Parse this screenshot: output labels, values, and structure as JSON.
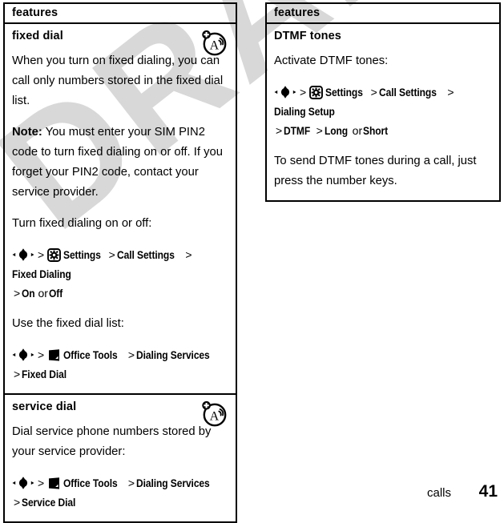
{
  "document": {
    "watermark_text": "DRAFT",
    "watermark_color": "#d8d8d8"
  },
  "footer": {
    "chapter": "calls",
    "page_number": "41"
  },
  "left_table": {
    "header": "features",
    "sections": [
      {
        "title": "fixed dial",
        "badge_icon": "sim-network-feature-icon",
        "blocks": [
          {
            "kind": "para",
            "text": "When you turn on fixed dialing, you can call only numbers stored in the fixed dial list."
          },
          {
            "kind": "note",
            "label": "Note:",
            "text": " You must enter your SIM PIN2 code to turn fixed dialing on or off. If you forget your PIN2 code, contact your service provider."
          },
          {
            "kind": "para",
            "text": "Turn fixed dialing on or off:"
          },
          {
            "kind": "navpath",
            "items": [
              {
                "type": "icon",
                "icon": "joystick-icon"
              },
              {
                "type": "sep",
                "text": ">"
              },
              {
                "type": "icon",
                "icon": "settings-gear-icon"
              },
              {
                "type": "nav",
                "text": "Settings"
              },
              {
                "type": "sep",
                "text": ">"
              },
              {
                "type": "nav",
                "text": "Call Settings"
              },
              {
                "type": "sep",
                "text": ">"
              },
              {
                "type": "nav",
                "text": "Fixed Dialing"
              },
              {
                "type": "break"
              },
              {
                "type": "sep",
                "text": ">"
              },
              {
                "type": "nav",
                "text": "On"
              },
              {
                "type": "plain",
                "text": "or"
              },
              {
                "type": "nav",
                "text": "Off"
              }
            ]
          },
          {
            "kind": "para",
            "text": "Use the fixed dial list:"
          },
          {
            "kind": "navpath",
            "items": [
              {
                "type": "icon",
                "icon": "joystick-icon"
              },
              {
                "type": "sep",
                "text": ">"
              },
              {
                "type": "icon",
                "icon": "office-tools-icon"
              },
              {
                "type": "nav",
                "text": "Office Tools"
              },
              {
                "type": "sep",
                "text": ">"
              },
              {
                "type": "nav",
                "text": "Dialing Services"
              },
              {
                "type": "sep",
                "text": ">"
              },
              {
                "type": "nav",
                "text": "Fixed Dial"
              }
            ]
          }
        ]
      },
      {
        "title": "service dial",
        "badge_icon": "sim-network-feature-icon",
        "blocks": [
          {
            "kind": "para",
            "text": "Dial service phone numbers stored by your service provider:"
          },
          {
            "kind": "navpath",
            "items": [
              {
                "type": "icon",
                "icon": "joystick-icon"
              },
              {
                "type": "sep",
                "text": ">"
              },
              {
                "type": "icon",
                "icon": "office-tools-icon"
              },
              {
                "type": "nav",
                "text": "Office Tools"
              },
              {
                "type": "sep",
                "text": ">"
              },
              {
                "type": "nav",
                "text": "Dialing Services"
              },
              {
                "type": "break"
              },
              {
                "type": "sep",
                "text": ">"
              },
              {
                "type": "nav",
                "text": "Service Dial"
              }
            ]
          }
        ]
      }
    ]
  },
  "right_table": {
    "header": "features",
    "sections": [
      {
        "title": "DTMF tones",
        "badge_icon": null,
        "blocks": [
          {
            "kind": "para",
            "text": "Activate DTMF tones:"
          },
          {
            "kind": "navpath",
            "items": [
              {
                "type": "icon",
                "icon": "joystick-icon"
              },
              {
                "type": "sep",
                "text": ">"
              },
              {
                "type": "icon",
                "icon": "settings-gear-icon"
              },
              {
                "type": "nav",
                "text": "Settings"
              },
              {
                "type": "sep",
                "text": ">"
              },
              {
                "type": "nav",
                "text": "Call Settings"
              },
              {
                "type": "sep",
                "text": ">"
              },
              {
                "type": "nav",
                "text": "Dialing Setup"
              },
              {
                "type": "break"
              },
              {
                "type": "sep",
                "text": ">"
              },
              {
                "type": "nav",
                "text": "DTMF"
              },
              {
                "type": "sep",
                "text": ">"
              },
              {
                "type": "nav",
                "text": "Long"
              },
              {
                "type": "plain",
                "text": "or"
              },
              {
                "type": "nav",
                "text": "Short"
              }
            ]
          },
          {
            "kind": "para",
            "text": "To send DTMF tones during a call, just press the number keys."
          }
        ]
      }
    ]
  }
}
